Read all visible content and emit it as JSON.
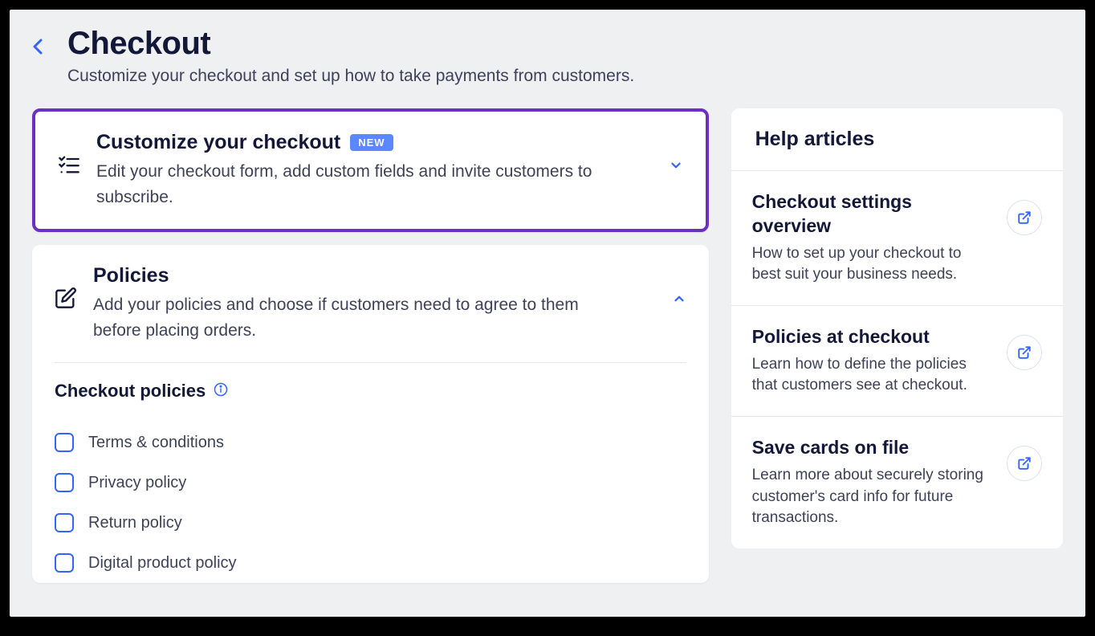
{
  "header": {
    "title": "Checkout",
    "subtitle": "Customize your checkout and set up how to take payments from customers."
  },
  "customize_card": {
    "title": "Customize your checkout",
    "badge": "NEW",
    "description": "Edit your checkout form, add custom fields and invite customers to subscribe."
  },
  "policies_card": {
    "title": "Policies",
    "description": "Add your policies and choose if customers need to agree to them before placing orders.",
    "section_title": "Checkout policies",
    "items": [
      {
        "label": "Terms & conditions"
      },
      {
        "label": "Privacy policy"
      },
      {
        "label": "Return policy"
      },
      {
        "label": "Digital product policy"
      }
    ]
  },
  "help": {
    "heading": "Help articles",
    "items": [
      {
        "title": "Checkout settings overview",
        "desc": "How to set up your checkout to best suit your business needs."
      },
      {
        "title": "Policies at checkout",
        "desc": "Learn how to define the policies that customers see at checkout."
      },
      {
        "title": "Save cards on file",
        "desc": "Learn more about securely storing customer's card info for future transactions."
      }
    ]
  }
}
